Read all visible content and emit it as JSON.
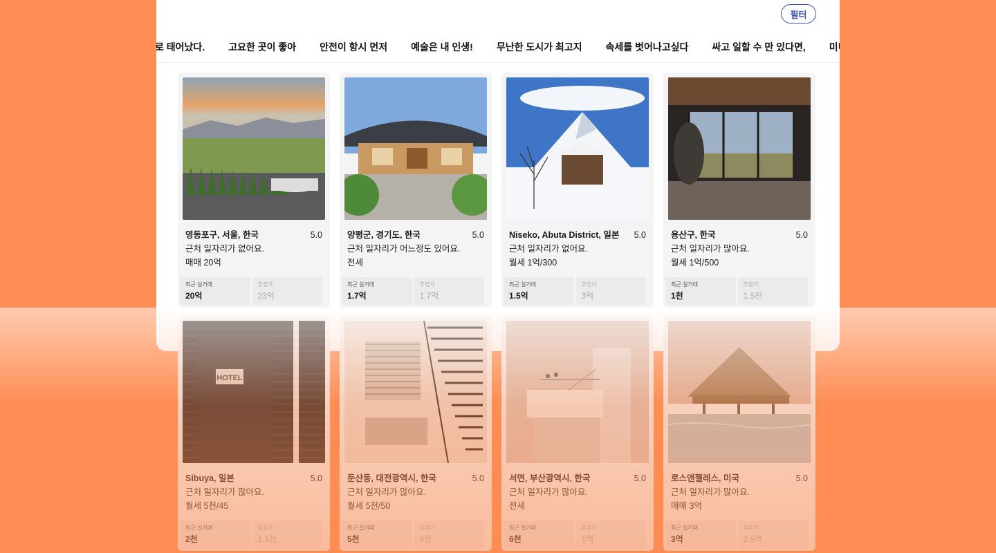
{
  "filter_label": "필터",
  "tabs": [
    "로 태어났다.",
    "고요한 곳이 좋아",
    "안전이 항시 먼저",
    "예술은 내 인생!",
    "무난한 도시가 최고지",
    "속세를 벗어나고싶다",
    "싸고 일할 수 만 있다면,",
    "미니멀라이프 초소형"
  ],
  "stat_labels": {
    "recent": "최근 실거래",
    "estimate": "추정가"
  },
  "listings": [
    {
      "location": "영등포구, 서울, 한국",
      "rating": "5.0",
      "jobs": "근처 일자리가 없어요.",
      "price": "매매 20억",
      "recent": "20억",
      "estimate": "23억",
      "image": "field-sunset-image"
    },
    {
      "location": "양평군, 경기도, 한국",
      "rating": "5.0",
      "jobs": "근처 일자리가 어느정도 있어요.",
      "price": "전세",
      "recent": "1.7억",
      "estimate": "1.7억",
      "image": "hanok-image"
    },
    {
      "location": "Niseko, Abuta District, 일본",
      "rating": "5.0",
      "jobs": "근처 일자리가 없어요.",
      "price": "월세 1억/300",
      "recent": "1.5억",
      "estimate": "3억",
      "image": "snow-mountain-image"
    },
    {
      "location": "용산구, 한국",
      "rating": "5.0",
      "jobs": "근처 일자리가 많아요.",
      "price": "월세 1억/500",
      "recent": "1천",
      "estimate": "1.5천",
      "image": "interior-window-image"
    },
    {
      "location": "Sibuya, 일본",
      "rating": "5.0",
      "jobs": "근처 일자리가 많아요.",
      "price": "월세 5천/45",
      "recent": "2천",
      "estimate": "1.5천",
      "image": "hotel-sign-image"
    },
    {
      "location": "둔산동, 대전광역시, 한국",
      "rating": "5.0",
      "jobs": "근처 일자리가 많아요.",
      "price": "월세 5천/50",
      "recent": "5천",
      "estimate": "5천",
      "image": "loft-stairs-image"
    },
    {
      "location": "서면, 부산광역시, 한국",
      "rating": "5.0",
      "jobs": "근처 일자리가 많아요.",
      "price": "전세",
      "recent": "6천",
      "estimate": "1억",
      "image": "container-tower-image"
    },
    {
      "location": "로스앤젤레스, 미국",
      "rating": "5.0",
      "jobs": "근처 일자리가 많아요.",
      "price": "매매 3억",
      "recent": "3억",
      "estimate": "2.5억",
      "image": "thatched-pool-bar-image"
    }
  ],
  "colors": {
    "background": "#ff8c52",
    "accent": "#3b4fb8"
  }
}
